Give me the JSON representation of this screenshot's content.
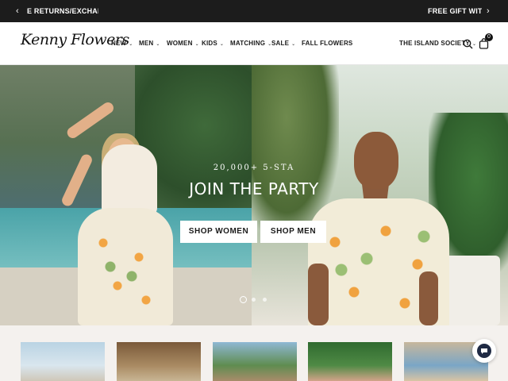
{
  "announcement": {
    "prev_arrow": "‹",
    "next_arrow": "›",
    "message_left": "E RETURNS/EXCHANGES",
    "message_right": "FREE GIFT WITH YOUR"
  },
  "header": {
    "logo": "Kenny Flowers",
    "nav": [
      {
        "label": "NEW"
      },
      {
        "label": "MEN"
      },
      {
        "label": "WOMEN"
      },
      {
        "label": "KIDS"
      },
      {
        "label": "MATCHING"
      },
      {
        "label": "SALE"
      },
      {
        "label": "FALL FLOWERS"
      }
    ],
    "island_society": "THE ISLAND SOCIETY",
    "cart_count": "0",
    "icons": [
      "search-icon",
      "cart-icon",
      "chevron-down-icon"
    ]
  },
  "hero": {
    "subtitle": "20,000+ 5-STA",
    "title": "JOIN THE PARTY",
    "cta_women": "SHOP WOMEN",
    "cta_men": "SHOP MEN",
    "slide_count": 3,
    "active_slide": 1
  },
  "colors": {
    "announcement_bg": "#1c1c1c",
    "accent": "#1a1a1a",
    "strip_bg": "#f4f1ee"
  }
}
